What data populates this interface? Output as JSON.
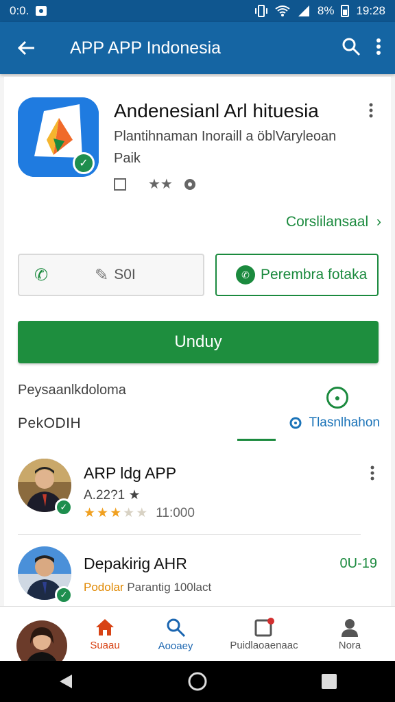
{
  "status_bar": {
    "time_left": "0:0.",
    "battery": "8%",
    "time_right": "19:28"
  },
  "app_bar": {
    "title": "APP APP Indonesia",
    "back_icon": "arrow-back-icon",
    "search_icon": "search-icon",
    "more_icon": "more-vert-icon"
  },
  "app": {
    "title": "Andenesianl Arl hituesia",
    "subtitle_line1": "Plantihnaman Inoraill a öblVaryleoan",
    "subtitle_line2": "Paik",
    "link": "Corslilansaal",
    "call_button_label": "S0I",
    "whatsapp_button_label": "Perembra fotaka",
    "install_button_label": "Unduy"
  },
  "section": {
    "label": "Peysaanlkdoloma",
    "heading": "PekODIH",
    "tab_link": "Tlasnlhahon"
  },
  "list": [
    {
      "title": "ARP ldg APP",
      "rating_text": "A.22?1 ★",
      "stars": 3.5,
      "count": "11:000"
    },
    {
      "title": "Depakirig AHR",
      "sub_highlight": "Podolar",
      "sub_rest": "Parantig 100lact",
      "right_text": "0U-19"
    }
  ],
  "bottom_nav": {
    "home_label": "Suaau",
    "search_label": "Aooaey",
    "updates_label": "Puidlaoaenaac",
    "account_label": "Nora"
  },
  "colors": {
    "app_bar": "#1565a3",
    "status_bar": "#0f568f",
    "primary_green": "#1e8e3e",
    "link_blue": "#1a73b8",
    "star": "#f0a020",
    "home_active": "#d84315"
  }
}
